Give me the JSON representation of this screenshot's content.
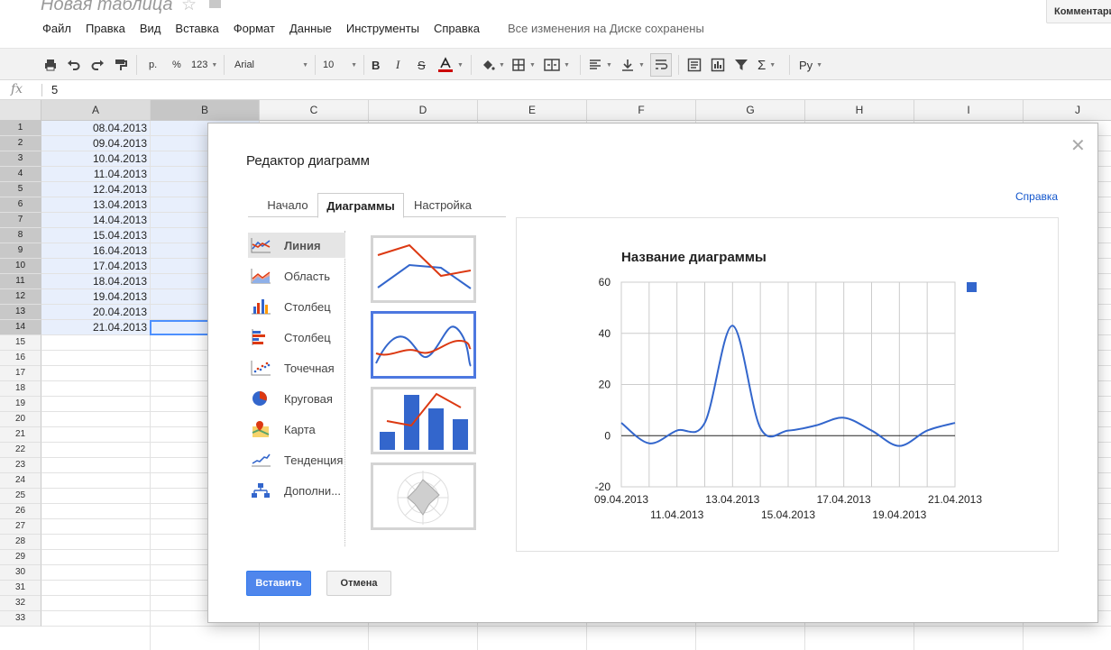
{
  "doc": {
    "title": "Новая таблица",
    "star": "☆",
    "comments_label": "Комментарии"
  },
  "menu": {
    "items": [
      "Файл",
      "Правка",
      "Вид",
      "Вставка",
      "Формат",
      "Данные",
      "Инструменты",
      "Справка"
    ],
    "saved_status": "Все изменения на Диске сохранены"
  },
  "toolbar": {
    "currency": "р.",
    "percent": "%",
    "number_format": "123",
    "font": "Arial",
    "font_size": "10",
    "input_tools": "Ру",
    "text_color": "#cc0000"
  },
  "formula_bar": {
    "fx": "fx",
    "value": "5"
  },
  "sheet": {
    "columns": [
      "A",
      "B",
      "C",
      "D",
      "E",
      "F",
      "G",
      "H",
      "I",
      "J"
    ],
    "rows": [
      "1",
      "2",
      "3",
      "4",
      "5",
      "6",
      "7",
      "8",
      "9",
      "10",
      "11",
      "12",
      "13",
      "14",
      "15",
      "16",
      "17",
      "18",
      "19",
      "20",
      "21",
      "22",
      "23",
      "24",
      "25",
      "26",
      "27",
      "28",
      "29",
      "30",
      "31",
      "32",
      "33"
    ],
    "col_a": [
      "08.04.2013",
      "09.04.2013",
      "10.04.2013",
      "11.04.2013",
      "12.04.2013",
      "13.04.2013",
      "14.04.2013",
      "15.04.2013",
      "16.04.2013",
      "17.04.2013",
      "18.04.2013",
      "19.04.2013",
      "20.04.2013",
      "21.04.2013"
    ]
  },
  "dialog": {
    "title": "Редактор диаграмм",
    "help": "Справка",
    "tabs": [
      "Начало",
      "Диаграммы",
      "Настройка"
    ],
    "active_tab": "Диаграммы",
    "chart_types": [
      {
        "label": "Линия",
        "icon": "line-chart-icon"
      },
      {
        "label": "Область",
        "icon": "area-chart-icon"
      },
      {
        "label": "Столбец",
        "icon": "column-chart-icon"
      },
      {
        "label": "Столбец",
        "icon": "bar-chart-icon"
      },
      {
        "label": "Точечная",
        "icon": "scatter-chart-icon"
      },
      {
        "label": "Круговая",
        "icon": "pie-chart-icon"
      },
      {
        "label": "Карта",
        "icon": "map-chart-icon"
      },
      {
        "label": "Тенденция",
        "icon": "trend-chart-icon"
      },
      {
        "label": "Дополни...",
        "icon": "more-charts-icon"
      }
    ],
    "insert_label": "Вставить",
    "cancel_label": "Отмена",
    "series_color": "#3366cc",
    "accent_color": "#4d90fe"
  },
  "chart_data": {
    "type": "line",
    "title": "Название диаграммы",
    "xlabel": "",
    "ylabel": "",
    "x": [
      "09.04.2013",
      "10.04.2013",
      "11.04.2013",
      "12.04.2013",
      "13.04.2013",
      "14.04.2013",
      "15.04.2013",
      "16.04.2013",
      "17.04.2013",
      "18.04.2013",
      "19.04.2013",
      "20.04.2013",
      "21.04.2013"
    ],
    "x_ticks_row1": [
      "09.04.2013",
      "13.04.2013",
      "17.04.2013",
      "21.04.2013"
    ],
    "x_ticks_row2": [
      "11.04.2013",
      "15.04.2013",
      "19.04.2013"
    ],
    "y_ticks": [
      "60",
      "40",
      "20",
      "0",
      "-20"
    ],
    "ylim": [
      -20,
      60
    ],
    "grid": true,
    "legend": "top-right",
    "series": [
      {
        "values": [
          5,
          -3,
          2,
          5,
          43,
          3,
          2,
          4,
          7,
          2,
          -4,
          2,
          5
        ]
      }
    ]
  }
}
